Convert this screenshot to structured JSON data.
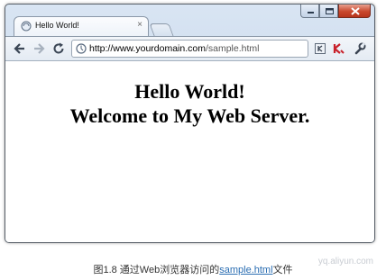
{
  "browser": {
    "tab": {
      "title": "Hello World!",
      "close_glyph": "×",
      "favicon": "page-globe-icon"
    },
    "window_controls": [
      "minimize-icon",
      "maximize-icon",
      "close-icon"
    ],
    "toolbar": {
      "back_icon": "back-arrow-icon",
      "forward_icon": "forward-arrow-icon",
      "reload_icon": "reload-icon",
      "url_scheme_host": "http://www.yourdomain.com",
      "url_path": "/sample.html",
      "extensions": [
        "bookmark-icon",
        "antivirus-icon",
        "wrench-icon"
      ]
    }
  },
  "page": {
    "line1": "Hello World!",
    "line2": "Welcome to My Web Server."
  },
  "caption": {
    "prefix": "图1.8  通过Web浏览器访问的",
    "link": "sample.html",
    "suffix": "文件"
  },
  "watermark": "yq.aliyun.com",
  "colors": {
    "frame": "#c4d5ea",
    "close_button": "#c9472c",
    "caption_link": "#2a6db2"
  }
}
